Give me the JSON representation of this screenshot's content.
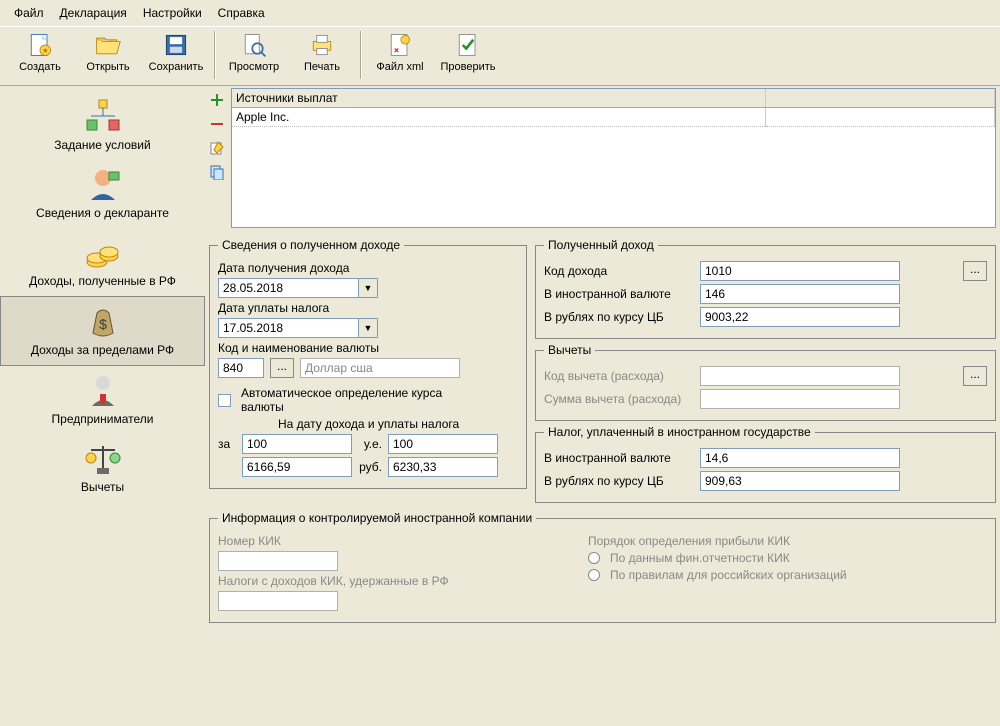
{
  "menu": {
    "file": "Файл",
    "decl": "Декларация",
    "settings": "Настройки",
    "help": "Справка"
  },
  "toolbar": {
    "create": "Создать",
    "open": "Открыть",
    "save": "Сохранить",
    "preview": "Просмотр",
    "print": "Печать",
    "xml": "Файл xml",
    "check": "Проверить"
  },
  "sidebar": {
    "conditions": "Задание условий",
    "declarant": "Сведения о декларанте",
    "income_rf": "Доходы, полученные в РФ",
    "income_foreign": "Доходы за пределами РФ",
    "entrepreneurs": "Предприниматели",
    "deductions": "Вычеты"
  },
  "grid": {
    "header": "Источники выплат",
    "row0": "Apple Inc."
  },
  "form": {
    "left": {
      "legend": "Сведения о полученном доходе",
      "date_recv_label": "Дата получения дохода",
      "date_recv": "28.05.2018",
      "date_tax_label": "Дата уплаты налога",
      "date_tax": "17.05.2018",
      "currency_label": "Код и наименование валюты",
      "currency_code": "840",
      "currency_name": "Доллар сша",
      "auto_label": "Автоматическое определение курса валюты",
      "rate_hdr": "На дату дохода и уплаты налога",
      "za": "за",
      "ue": "у.е.",
      "rub": "руб.",
      "val_za": "100",
      "val_ue": "100",
      "val_rub1": "6166,59",
      "val_rub2": "6230,33"
    },
    "right_income": {
      "legend": "Полученный доход",
      "code_label": "Код дохода",
      "code": "1010",
      "foreign_label": "В иностранной валюте",
      "foreign": "146",
      "rub_label": "В рублях по курсу ЦБ",
      "rub": "9003,22"
    },
    "right_deduct": {
      "legend": "Вычеты",
      "code_label": "Код вычета (расхода)",
      "sum_label": "Сумма вычета (расхода)"
    },
    "right_tax": {
      "legend": "Налог, уплаченный в иностранном государстве",
      "foreign_label": "В иностранной валюте",
      "foreign": "14,6",
      "rub_label": "В рублях по курсу ЦБ",
      "rub": "909,63"
    },
    "kik": {
      "legend": "Информация о контролируемой иностранной компании",
      "num_label": "Номер КИК",
      "tax_label": "Налоги с доходов КИК, удержанные в РФ",
      "order_label": "Порядок определения прибыли КИК",
      "radio1": "По данным фин.отчетности КИК",
      "radio2": "По правилам для российских организаций"
    }
  }
}
